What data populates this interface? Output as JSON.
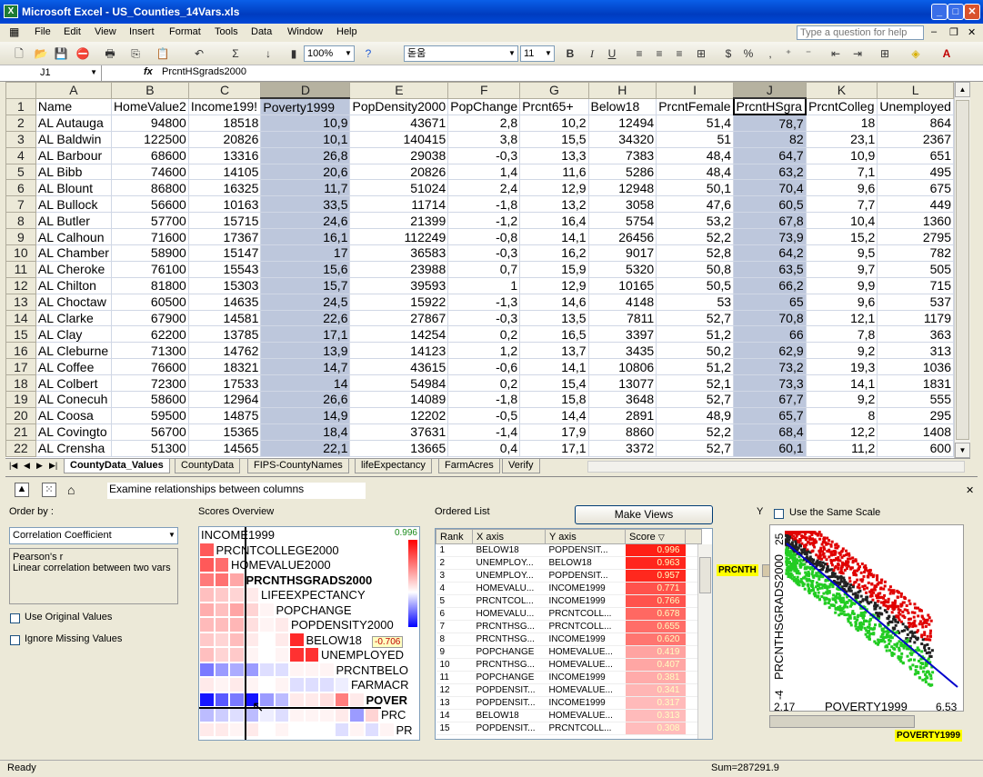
{
  "window": {
    "title": "Microsoft Excel - US_Counties_14Vars.xls",
    "icon": "excel-icon",
    "buttons": [
      "minimize-icon",
      "maximize-icon",
      "close-icon"
    ]
  },
  "menu": {
    "items": [
      "File",
      "Edit",
      "View",
      "Insert",
      "Format",
      "Tools",
      "Data",
      "Window",
      "Help"
    ],
    "help_placeholder": "Type a question for help"
  },
  "toolbar": {
    "zoom": "100%",
    "font": "돋움",
    "font_size": "11",
    "bold": "B",
    "italic": "I",
    "underline": "U"
  },
  "formula": {
    "name_box": "J1",
    "fx": "fx",
    "value": "PrcntHSgrads2000"
  },
  "sheet": {
    "columns": [
      "A",
      "B",
      "C",
      "D",
      "E",
      "F",
      "G",
      "H",
      "I",
      "J",
      "K",
      "L"
    ],
    "rows": [
      [
        "1",
        "Name",
        "HomeValue2",
        "Income199!",
        "Poverty1999",
        "PopDensity2000",
        "PopChange",
        "Prcnt65+",
        "Below18",
        "PrcntFemale",
        "PrcntHSgra",
        "PrcntColleg",
        "Unemployed"
      ],
      [
        "2",
        "AL Autauga",
        "94800",
        "18518",
        "10,9",
        "43671",
        "2,8",
        "10,2",
        "12494",
        "51,4",
        "78,7",
        "18",
        "864"
      ],
      [
        "3",
        "AL Baldwin",
        "122500",
        "20826",
        "10,1",
        "140415",
        "3,8",
        "15,5",
        "34320",
        "51",
        "82",
        "23,1",
        "2367"
      ],
      [
        "4",
        "AL Barbour",
        "68600",
        "13316",
        "26,8",
        "29038",
        "-0,3",
        "13,3",
        "7383",
        "48,4",
        "64,7",
        "10,9",
        "651"
      ],
      [
        "5",
        "AL Bibb",
        "74600",
        "14105",
        "20,6",
        "20826",
        "1,4",
        "11,6",
        "5286",
        "48,4",
        "63,2",
        "7,1",
        "495"
      ],
      [
        "6",
        "AL Blount",
        "86800",
        "16325",
        "11,7",
        "51024",
        "2,4",
        "12,9",
        "12948",
        "50,1",
        "70,4",
        "9,6",
        "675"
      ],
      [
        "7",
        "AL Bullock",
        "56600",
        "10163",
        "33,5",
        "11714",
        "-1,8",
        "13,2",
        "3058",
        "47,6",
        "60,5",
        "7,7",
        "449"
      ],
      [
        "8",
        "AL Butler",
        "57700",
        "15715",
        "24,6",
        "21399",
        "-1,2",
        "16,4",
        "5754",
        "53,2",
        "67,8",
        "10,4",
        "1360"
      ],
      [
        "9",
        "AL Calhoun",
        "71600",
        "17367",
        "16,1",
        "112249",
        "-0,8",
        "14,1",
        "26456",
        "52,2",
        "73,9",
        "15,2",
        "2795"
      ],
      [
        "10",
        "AL Chamber",
        "58900",
        "15147",
        "17",
        "36583",
        "-0,3",
        "16,2",
        "9017",
        "52,8",
        "64,2",
        "9,5",
        "782"
      ],
      [
        "11",
        "AL Cheroke",
        "76100",
        "15543",
        "15,6",
        "23988",
        "0,7",
        "15,9",
        "5320",
        "50,8",
        "63,5",
        "9,7",
        "505"
      ],
      [
        "12",
        "AL Chilton",
        "81800",
        "15303",
        "15,7",
        "39593",
        "1",
        "12,9",
        "10165",
        "50,5",
        "66,2",
        "9,9",
        "715"
      ],
      [
        "13",
        "AL Choctaw",
        "60500",
        "14635",
        "24,5",
        "15922",
        "-1,3",
        "14,6",
        "4148",
        "53",
        "65",
        "9,6",
        "537"
      ],
      [
        "14",
        "AL Clarke",
        "67900",
        "14581",
        "22,6",
        "27867",
        "-0,3",
        "13,5",
        "7811",
        "52,7",
        "70,8",
        "12,1",
        "1179"
      ],
      [
        "15",
        "AL Clay",
        "62200",
        "13785",
        "17,1",
        "14254",
        "0,2",
        "16,5",
        "3397",
        "51,2",
        "66",
        "7,8",
        "363"
      ],
      [
        "16",
        "AL Cleburne",
        "71300",
        "14762",
        "13,9",
        "14123",
        "1,2",
        "13,7",
        "3435",
        "50,2",
        "62,9",
        "9,2",
        "313"
      ],
      [
        "17",
        "AL Coffee",
        "76600",
        "18321",
        "14,7",
        "43615",
        "-0,6",
        "14,1",
        "10806",
        "51,2",
        "73,2",
        "19,3",
        "1036"
      ],
      [
        "18",
        "AL Colbert",
        "72300",
        "17533",
        "14",
        "54984",
        "0,2",
        "15,4",
        "13077",
        "52,1",
        "73,3",
        "14,1",
        "1831"
      ],
      [
        "19",
        "AL Conecuh",
        "58600",
        "12964",
        "26,6",
        "14089",
        "-1,8",
        "15,8",
        "3648",
        "52,7",
        "67,7",
        "9,2",
        "555"
      ],
      [
        "20",
        "AL Coosa",
        "59500",
        "14875",
        "14,9",
        "12202",
        "-0,5",
        "14,4",
        "2891",
        "48,9",
        "65,7",
        "8",
        "295"
      ],
      [
        "21",
        "AL Covingto",
        "56700",
        "15365",
        "18,4",
        "37631",
        "-1,4",
        "17,9",
        "8860",
        "52,2",
        "68,4",
        "12,2",
        "1408"
      ],
      [
        "22",
        "AL Crensha",
        "51300",
        "14565",
        "22,1",
        "13665",
        "0,4",
        "17,1",
        "3372",
        "52,7",
        "60,1",
        "11,2",
        "600"
      ]
    ]
  },
  "tabs": [
    "CountyData_Values",
    "CountyData",
    "FIPS-CountyNames",
    "lifeExpectancy",
    "FarmAcres",
    "Verify"
  ],
  "panel": {
    "prompt": "Examine relationships between columns",
    "order_by_label": "Order by :",
    "order_by_value": "Correlation Coefficient",
    "desc_line1": "Pearson's r",
    "desc_line2": "Linear correlation between two vars",
    "opt_original": "Use Original Values",
    "opt_missing": "Ignore Missing Values",
    "scores_title": "Scores Overview",
    "scale_max": "0.996",
    "scale_min": "-0.706",
    "overview_labels": [
      "INCOME1999",
      "PRCNTCOLLEGE2000",
      "HOMEVALUE2000",
      "PRCNTHSGRADS2000",
      "LIFEEXPECTANCY",
      "POPCHANGE",
      "POPDENSITY2000",
      "BELOW18",
      "UNEMPLOYED",
      "PRCNTBELO",
      "FARMACR",
      "POVER",
      "PRC",
      "PR"
    ],
    "ordered_title": "Ordered List",
    "make_views": "Make Views",
    "ordered_headers": [
      "Rank",
      "X axis",
      "Y axis",
      "Score"
    ],
    "ordered_rows": [
      [
        "1",
        "BELOW18",
        "POPDENSIT...",
        "0.996"
      ],
      [
        "2",
        "UNEMPLOY...",
        "BELOW18",
        "0.963"
      ],
      [
        "3",
        "UNEMPLOY...",
        "POPDENSIT...",
        "0.957"
      ],
      [
        "4",
        "HOMEVALU...",
        "INCOME1999",
        "0.771"
      ],
      [
        "5",
        "PRCNTCOL...",
        "INCOME1999",
        "0.766"
      ],
      [
        "6",
        "HOMEVALU...",
        "PRCNTCOLL...",
        "0.678"
      ],
      [
        "7",
        "PRCNTHSG...",
        "PRCNTCOLL...",
        "0.655"
      ],
      [
        "8",
        "PRCNTHSG...",
        "INCOME1999",
        "0.620"
      ],
      [
        "9",
        "POPCHANGE",
        "HOMEVALUE...",
        "0.419"
      ],
      [
        "10",
        "PRCNTHSG...",
        "HOMEVALUE...",
        "0.407"
      ],
      [
        "11",
        "POPCHANGE",
        "INCOME1999",
        "0.381"
      ],
      [
        "12",
        "POPDENSIT...",
        "HOMEVALUE...",
        "0.341"
      ],
      [
        "13",
        "POPDENSIT...",
        "INCOME1999",
        "0.317"
      ],
      [
        "14",
        "BELOW18",
        "HOMEVALUE...",
        "0.313"
      ],
      [
        "15",
        "POPDENSIT...",
        "PRCNTCOLL...",
        "0.308"
      ]
    ],
    "y_label": "Y",
    "same_scale": "Use the Same Scale",
    "y_badge": "PRCNTH",
    "x_badge": "POVERTY1999",
    "scatter": {
      "xlabel": "POVERTY1999",
      "ylabel": "PRCNTHSGRADS2000",
      "xmin": "2.17",
      "xmax": "6.53",
      "ymin": "-4",
      "ymax": "25"
    }
  },
  "status": {
    "left": "Ready",
    "sum": "Sum=287291.9"
  }
}
